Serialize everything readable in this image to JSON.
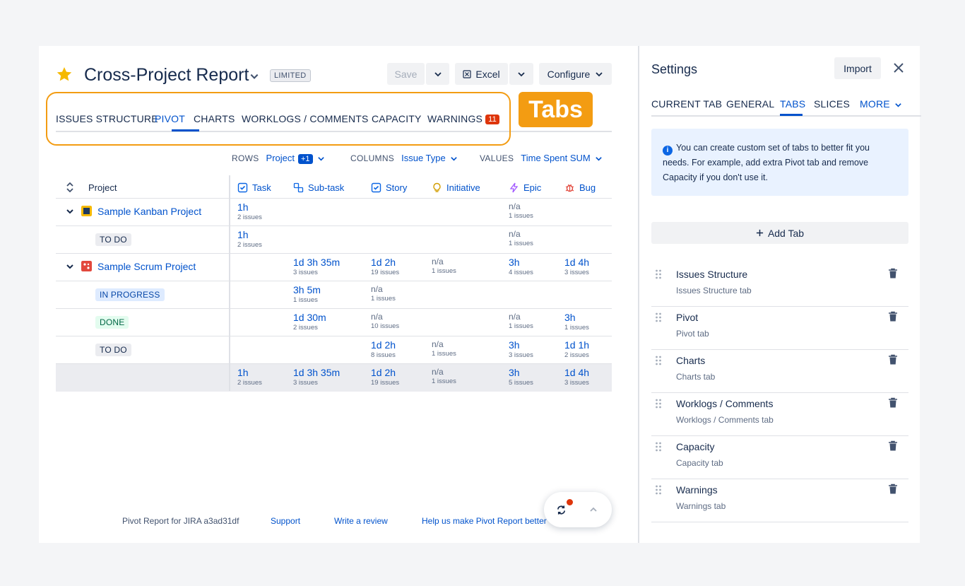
{
  "header": {
    "title": "Cross-Project Report",
    "badge": "LIMITED",
    "save_label": "Save",
    "excel_label": "Excel",
    "configure_label": "Configure"
  },
  "annotation": {
    "label": "Tabs",
    "color": "#f39c12"
  },
  "tabs": [
    {
      "label": "ISSUES STRUCTURE"
    },
    {
      "label": "PIVOT",
      "active": true
    },
    {
      "label": "CHARTS"
    },
    {
      "label": "WORKLOGS / COMMENTS"
    },
    {
      "label": "CAPACITY"
    },
    {
      "label": "WARNINGS",
      "count": "11"
    }
  ],
  "controls": {
    "rows_label": "ROWS",
    "rows_value": "Project",
    "rows_extra": "+1",
    "columns_label": "COLUMNS",
    "columns_value": "Issue Type",
    "values_label": "VALUES",
    "values_value": "Time Spent SUM"
  },
  "table": {
    "first_header": "Project",
    "columns": [
      {
        "label": "Task",
        "icon": "task-icon"
      },
      {
        "label": "Sub-task",
        "icon": "subtask-icon"
      },
      {
        "label": "Story",
        "icon": "story-icon"
      },
      {
        "label": "Initiative",
        "icon": "initiative-icon"
      },
      {
        "label": "Epic",
        "icon": "epic-icon"
      },
      {
        "label": "Bug",
        "icon": "bug-icon"
      }
    ],
    "rows": [
      {
        "kind": "project",
        "label": "Sample Kanban Project",
        "icon": "kanban-project-icon",
        "cells": [
          {
            "v": "1h",
            "s": "2 issues"
          },
          null,
          null,
          null,
          {
            "v": "n/a",
            "s": "1 issues"
          },
          null
        ]
      },
      {
        "kind": "status",
        "label": "TO DO",
        "status": "todo",
        "cells": [
          {
            "v": "1h",
            "s": "2 issues"
          },
          null,
          null,
          null,
          {
            "v": "n/a",
            "s": "1 issues"
          },
          null
        ]
      },
      {
        "kind": "project",
        "label": "Sample Scrum Project",
        "icon": "scrum-project-icon",
        "cells": [
          null,
          {
            "v": "1d 3h 35m",
            "s": "3 issues"
          },
          {
            "v": "1d 2h",
            "s": "19 issues"
          },
          {
            "v": "n/a",
            "s": "1 issues"
          },
          {
            "v": "3h",
            "s": "4 issues"
          },
          {
            "v": "1d 4h",
            "s": "3 issues"
          }
        ]
      },
      {
        "kind": "status",
        "label": "IN PROGRESS",
        "status": "progress",
        "cells": [
          null,
          {
            "v": "3h 5m",
            "s": "1 issues"
          },
          {
            "v": "n/a",
            "s": "1 issues"
          },
          null,
          null,
          null
        ]
      },
      {
        "kind": "status",
        "label": "DONE",
        "status": "done",
        "cells": [
          null,
          {
            "v": "1d 30m",
            "s": "2 issues"
          },
          {
            "v": "n/a",
            "s": "10 issues"
          },
          null,
          {
            "v": "n/a",
            "s": "1 issues"
          },
          {
            "v": "3h",
            "s": "1 issues"
          }
        ]
      },
      {
        "kind": "status",
        "label": "TO DO",
        "status": "todo",
        "cells": [
          null,
          null,
          {
            "v": "1d 2h",
            "s": "8 issues"
          },
          {
            "v": "n/a",
            "s": "1 issues"
          },
          {
            "v": "3h",
            "s": "3 issues"
          },
          {
            "v": "1d 1h",
            "s": "2 issues"
          }
        ]
      },
      {
        "kind": "total",
        "label": "",
        "cells": [
          {
            "v": "1h",
            "s": "2 issues"
          },
          {
            "v": "1d 3h 35m",
            "s": "3 issues"
          },
          {
            "v": "1d 2h",
            "s": "19 issues"
          },
          {
            "v": "n/a",
            "s": "1 issues"
          },
          {
            "v": "3h",
            "s": "5 issues"
          },
          {
            "v": "1d 4h",
            "s": "3 issues"
          }
        ]
      }
    ]
  },
  "footer": {
    "version": "Pivot Report for JIRA a3ad31df",
    "support": "Support",
    "review": "Write a review",
    "feedback": "Help us make Pivot Report better"
  },
  "settings": {
    "title": "Settings",
    "import_label": "Import",
    "tabs": [
      {
        "label": "CURRENT TAB"
      },
      {
        "label": "GENERAL"
      },
      {
        "label": "TABS",
        "active": true
      },
      {
        "label": "SLICES"
      },
      {
        "label": "MORE"
      }
    ],
    "info": "You can create custom set of tabs to better fit you needs. For example, add extra Pivot tab and remove Capacity if you don't use it.",
    "add_tab_label": "Add Tab",
    "tab_items": [
      {
        "name": "Issues Structure",
        "desc": "Issues Structure tab"
      },
      {
        "name": "Pivot",
        "desc": "Pivot tab"
      },
      {
        "name": "Charts",
        "desc": "Charts tab"
      },
      {
        "name": "Worklogs / Comments",
        "desc": "Worklogs / Comments tab"
      },
      {
        "name": "Capacity",
        "desc": "Capacity tab"
      },
      {
        "name": "Warnings",
        "desc": "Warnings tab"
      }
    ]
  }
}
